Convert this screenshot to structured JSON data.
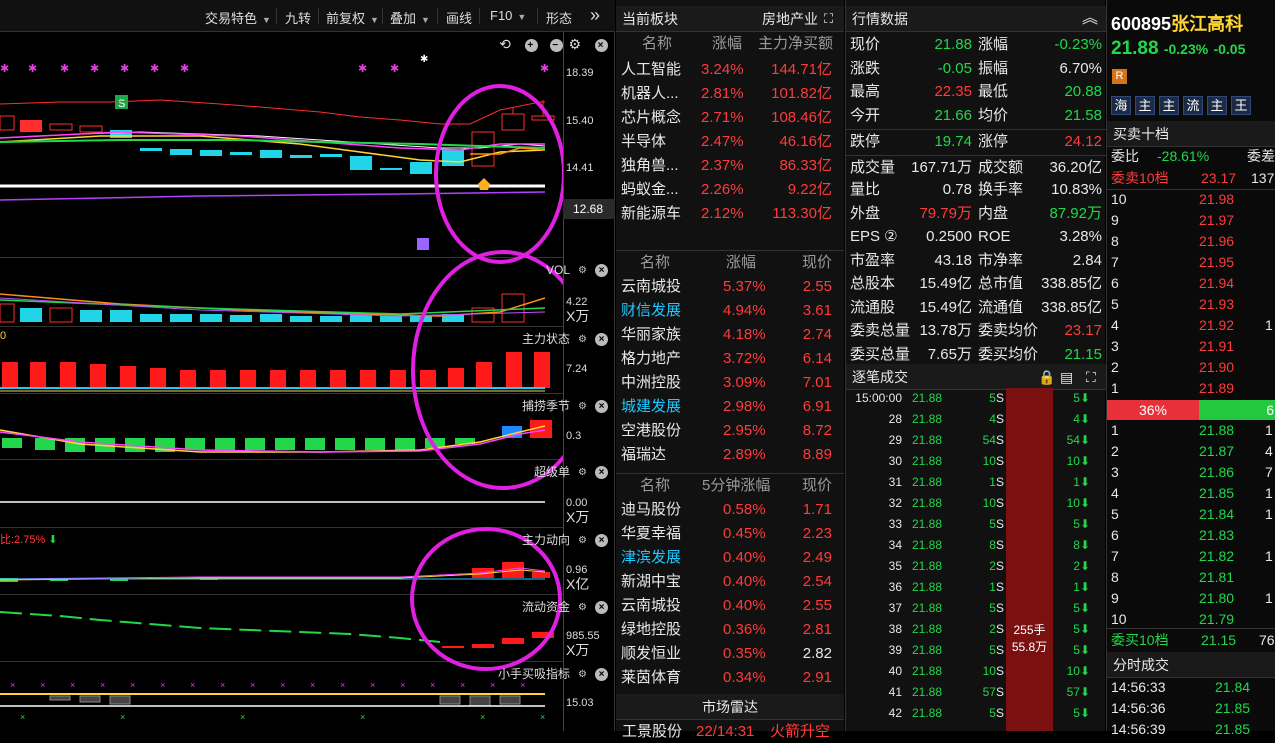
{
  "toolbar": {
    "items": [
      "交易特色",
      "九转",
      "前复权",
      "叠加",
      "画线",
      "F10",
      "形态"
    ],
    "expand": "»"
  },
  "price_panel": {
    "marker_star": "✱",
    "marker_s": "S",
    "axis": [
      "18.39",
      "15.40",
      "14.41"
    ],
    "current_tag": "12.68"
  },
  "panels": {
    "vol": {
      "title": "VOL",
      "axis": [
        "4.22",
        "X万"
      ]
    },
    "zhuli": {
      "title": "主力状态",
      "axis": [
        "7.24"
      ],
      "left_label": "0"
    },
    "buzhuo": {
      "title": "捕捞季节",
      "axis": [
        "0.3"
      ]
    },
    "chaoji": {
      "title": "超级单",
      "axis": [
        "0.00",
        "X万"
      ]
    },
    "zhudong": {
      "title": "主力动向",
      "axis": [
        "0.96",
        "X亿"
      ],
      "left_label": "比:2.75%"
    },
    "liudong": {
      "title": "流动资金",
      "axis": [
        "985.55",
        "X万"
      ]
    },
    "xiaotou": {
      "title": "小手买吸指标",
      "axis": [
        "15.03"
      ]
    }
  },
  "sector": {
    "title": "当前板块",
    "tab": "房地产业",
    "headers": [
      "名称",
      "涨幅",
      "主力净买额"
    ],
    "rows": [
      {
        "name": "人工智能",
        "pct": "3.24%",
        "val": "144.71亿"
      },
      {
        "name": "机器人...",
        "pct": "2.81%",
        "val": "101.82亿"
      },
      {
        "name": "芯片概念",
        "pct": "2.71%",
        "val": "108.46亿"
      },
      {
        "name": "半导体",
        "pct": "2.47%",
        "val": "46.16亿"
      },
      {
        "name": "独角兽...",
        "pct": "2.37%",
        "val": "86.33亿"
      },
      {
        "name": "蚂蚁金...",
        "pct": "2.26%",
        "val": "9.22亿"
      },
      {
        "name": "新能源车",
        "pct": "2.12%",
        "val": "113.30亿"
      }
    ]
  },
  "stocks": {
    "headers": [
      "名称",
      "涨幅",
      "现价"
    ],
    "rows": [
      {
        "name": "云南城投",
        "pct": "5.37%",
        "price": "2.55",
        "color": "#e8e8e8"
      },
      {
        "name": "财信发展",
        "pct": "4.94%",
        "price": "3.61",
        "color": "#1ec8ff"
      },
      {
        "name": "华丽家族",
        "pct": "4.18%",
        "price": "2.74",
        "color": "#e8e8e8"
      },
      {
        "name": "格力地产",
        "pct": "3.72%",
        "price": "6.14",
        "color": "#e8e8e8"
      },
      {
        "name": "中洲控股",
        "pct": "3.09%",
        "price": "7.01",
        "color": "#e8e8e8"
      },
      {
        "name": "城建发展",
        "pct": "2.98%",
        "price": "6.91",
        "color": "#1ec8ff"
      },
      {
        "name": "空港股份",
        "pct": "2.95%",
        "price": "8.72",
        "color": "#e8e8e8"
      },
      {
        "name": "福瑞达",
        "pct": "2.89%",
        "price": "8.89",
        "color": "#e8e8e8"
      }
    ]
  },
  "fivemin": {
    "headers": [
      "名称",
      "5分钟涨幅",
      "现价"
    ],
    "rows": [
      {
        "name": "迪马股份",
        "pct": "0.58%",
        "price": "1.71",
        "color": "#e8e8e8",
        "pcolor": "#ff3b3b"
      },
      {
        "name": "华夏幸福",
        "pct": "0.45%",
        "price": "2.23",
        "color": "#e8e8e8",
        "pcolor": "#ff3b3b"
      },
      {
        "name": "津滨发展",
        "pct": "0.40%",
        "price": "2.49",
        "color": "#1ec8ff",
        "pcolor": "#ff3b3b"
      },
      {
        "name": "新湖中宝",
        "pct": "0.40%",
        "price": "2.54",
        "color": "#e8e8e8",
        "pcolor": "#ff3b3b"
      },
      {
        "name": "云南城投",
        "pct": "0.40%",
        "price": "2.55",
        "color": "#e8e8e8",
        "pcolor": "#ff3b3b"
      },
      {
        "name": "绿地控股",
        "pct": "0.36%",
        "price": "2.81",
        "color": "#e8e8e8",
        "pcolor": "#ff3b3b"
      },
      {
        "name": "顺发恒业",
        "pct": "0.35%",
        "price": "2.82",
        "color": "#e8e8e8",
        "pcolor": "#e8e8e8"
      },
      {
        "name": "莱茵体育",
        "pct": "0.34%",
        "price": "2.91",
        "color": "#e8e8e8",
        "pcolor": "#ff3b3b"
      }
    ]
  },
  "radar": {
    "title": "市场雷达",
    "row": {
      "name": "工景股份",
      "time": "22/14:31",
      "event": "火箭升空"
    }
  },
  "quote": {
    "title": "行情数据",
    "rows": [
      {
        "l1": "现价",
        "v1": "21.88",
        "c1": "#22d84a",
        "l2": "涨幅",
        "v2": "-0.23%",
        "c2": "#22d84a"
      },
      {
        "l1": "涨跌",
        "v1": "-0.05",
        "c1": "#22d84a",
        "l2": "振幅",
        "v2": "6.70%",
        "c2": "#e8e8e8"
      },
      {
        "l1": "最高",
        "v1": "22.35",
        "c1": "#ff3b3b",
        "l2": "最低",
        "v2": "20.88",
        "c2": "#22d84a"
      },
      {
        "l1": "今开",
        "v1": "21.66",
        "c1": "#22d84a",
        "l2": "均价",
        "v2": "21.58",
        "c2": "#22d84a"
      },
      {
        "l1": "跌停",
        "v1": "19.74",
        "c1": "#22d84a",
        "l2": "涨停",
        "v2": "24.12",
        "c2": "#ff3b3b"
      },
      {
        "l1": "成交量",
        "v1": "167.71万",
        "c1": "#e8e8e8",
        "l2": "成交额",
        "v2": "36.20亿",
        "c2": "#e8e8e8"
      },
      {
        "l1": "量比",
        "v1": "0.78",
        "c1": "#e8e8e8",
        "l2": "换手率",
        "v2": "10.83%",
        "c2": "#e8e8e8"
      },
      {
        "l1": "外盘",
        "v1": "79.79万",
        "c1": "#ff3b3b",
        "l2": "内盘",
        "v2": "87.92万",
        "c2": "#22d84a"
      },
      {
        "l1": "EPS ②",
        "v1": "0.2500",
        "c1": "#e8e8e8",
        "l2": "ROE",
        "v2": "3.28%",
        "c2": "#e8e8e8"
      },
      {
        "l1": "市盈率",
        "v1": "43.18",
        "c1": "#e8e8e8",
        "l2": "市净率",
        "v2": "2.84",
        "c2": "#e8e8e8"
      },
      {
        "l1": "总股本",
        "v1": "15.49亿",
        "c1": "#e8e8e8",
        "l2": "总市值",
        "v2": "338.85亿",
        "c2": "#e8e8e8"
      },
      {
        "l1": "流通股",
        "v1": "15.49亿",
        "c1": "#e8e8e8",
        "l2": "流通值",
        "v2": "338.85亿",
        "c2": "#e8e8e8"
      },
      {
        "l1": "委卖总量",
        "v1": "13.78万",
        "c1": "#e8e8e8",
        "l2": "委卖均价",
        "v2": "23.17",
        "c2": "#ff3b3b"
      },
      {
        "l1": "委买总量",
        "v1": "7.65万",
        "c1": "#e8e8e8",
        "l2": "委买均价",
        "v2": "21.15",
        "c2": "#22d84a"
      }
    ]
  },
  "ticks": {
    "title": "逐笔成交",
    "rows": [
      {
        "t": "15:00:00",
        "p": "21.88",
        "v": "5",
        "s": "S",
        "d": "5"
      },
      {
        "t": "28",
        "p": "21.88",
        "v": "4",
        "s": "S",
        "d": "4"
      },
      {
        "t": "29",
        "p": "21.88",
        "v": "54",
        "s": "S",
        "d": "54"
      },
      {
        "t": "30",
        "p": "21.88",
        "v": "10",
        "s": "S",
        "d": "10"
      },
      {
        "t": "31",
        "p": "21.88",
        "v": "1",
        "s": "S",
        "d": "1"
      },
      {
        "t": "32",
        "p": "21.88",
        "v": "10",
        "s": "S",
        "d": "10"
      },
      {
        "t": "33",
        "p": "21.88",
        "v": "5",
        "s": "S",
        "d": "5"
      },
      {
        "t": "34",
        "p": "21.88",
        "v": "8",
        "s": "S",
        "d": "8"
      },
      {
        "t": "35",
        "p": "21.88",
        "v": "2",
        "s": "S",
        "d": "2"
      },
      {
        "t": "36",
        "p": "21.88",
        "v": "1",
        "s": "S",
        "d": "1"
      },
      {
        "t": "37",
        "p": "21.88",
        "v": "5",
        "s": "S",
        "d": "5"
      },
      {
        "t": "38",
        "p": "21.88",
        "v": "2",
        "s": "S",
        "d": "5"
      },
      {
        "t": "39",
        "p": "21.88",
        "v": "5",
        "s": "S",
        "d": "5"
      },
      {
        "t": "40",
        "p": "21.88",
        "v": "10",
        "s": "S",
        "d": "10"
      },
      {
        "t": "41",
        "p": "21.88",
        "v": "57",
        "s": "S",
        "d": "57"
      },
      {
        "t": "42",
        "p": "21.88",
        "v": "5",
        "s": "S",
        "d": "5"
      }
    ],
    "summary_qty": "255手",
    "summary_amt": "55.8万"
  },
  "stock": {
    "code": "600895",
    "name": "张江高科",
    "price": "21.88",
    "chg_pct": "-0.23%",
    "chg": "-0.05",
    "badge": "R",
    "tags": [
      "海",
      "主",
      "主",
      "流",
      "主",
      "王"
    ]
  },
  "book": {
    "title": "买卖十档",
    "wb_label": "委比",
    "wb_value": "-28.61%",
    "wc_label": "委差",
    "sell10_label": "委卖10档",
    "sell10_price": "23.17",
    "sell10_vol": "137",
    "sells": [
      {
        "lv": "10",
        "p": "21.98",
        "v": ""
      },
      {
        "lv": "9",
        "p": "21.97",
        "v": ""
      },
      {
        "lv": "8",
        "p": "21.96",
        "v": ""
      },
      {
        "lv": "7",
        "p": "21.95",
        "v": ""
      },
      {
        "lv": "6",
        "p": "21.94",
        "v": ""
      },
      {
        "lv": "5",
        "p": "21.93",
        "v": ""
      },
      {
        "lv": "4",
        "p": "21.92",
        "v": "1"
      },
      {
        "lv": "3",
        "p": "21.91",
        "v": ""
      },
      {
        "lv": "2",
        "p": "21.90",
        "v": ""
      },
      {
        "lv": "1",
        "p": "21.89",
        "v": ""
      }
    ],
    "ratio_sell": "36%",
    "ratio_buy": "6",
    "buys": [
      {
        "lv": "1",
        "p": "21.88",
        "v": "1"
      },
      {
        "lv": "2",
        "p": "21.87",
        "v": "4"
      },
      {
        "lv": "3",
        "p": "21.86",
        "v": "7"
      },
      {
        "lv": "4",
        "p": "21.85",
        "v": "1"
      },
      {
        "lv": "5",
        "p": "21.84",
        "v": "1"
      },
      {
        "lv": "6",
        "p": "21.83",
        "v": ""
      },
      {
        "lv": "7",
        "p": "21.82",
        "v": "1"
      },
      {
        "lv": "8",
        "p": "21.81",
        "v": ""
      },
      {
        "lv": "9",
        "p": "21.80",
        "v": "1"
      },
      {
        "lv": "10",
        "p": "21.79",
        "v": ""
      }
    ],
    "buy10_label": "委买10档",
    "buy10_price": "21.15",
    "buy10_vol": "76"
  },
  "timeshare": {
    "title": "分时成交",
    "rows": [
      {
        "t": "14:56:33",
        "p": "21.84"
      },
      {
        "t": "14:56:36",
        "p": "21.85"
      },
      {
        "t": "14:56:39",
        "p": "21.85"
      }
    ]
  }
}
